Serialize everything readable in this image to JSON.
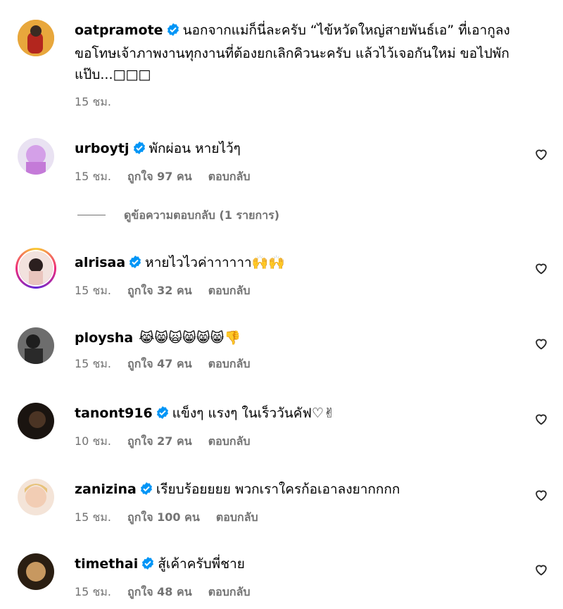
{
  "comments": [
    {
      "username": "oatpramote",
      "verified": true,
      "text": "นอกจากแม่ก็นี่ละครับ “ไข้หวัดใหญ่สายพันธ์เอ” ที่เอากูลง ขอโทษเจ้าภาพงานทุกงานที่ต้องยกเลิกคิวนะครับ แล้วไว้เจอกันใหม่ ขอไปพักแป๊บ...",
      "emoji_tail": "□□□",
      "time": "15 ชม.",
      "likes": "",
      "reply": "",
      "avatar_color": "#c0392b"
    },
    {
      "username": "urboytj",
      "verified": true,
      "text": "พักผ่อน หายไว้ๆ",
      "time": "15 ชม.",
      "likes": "ถูกใจ 97 คน",
      "reply": "ตอบกลับ",
      "avatar_color": "#d9b8f0"
    },
    {
      "username": "alrisaa",
      "verified": true,
      "text": "หายไวไวค่าาาาาา",
      "emoji_tail": "🙌🙌",
      "time": "15 ชม.",
      "likes": "ถูกใจ 32 คน",
      "reply": "ตอบกลับ",
      "avatar_color": "#e8c9c2"
    },
    {
      "username": "ploysha",
      "verified": false,
      "text": "",
      "emoji_tail": "😹😸🙀😸😸😸👎",
      "time": "15 ชม.",
      "likes": "ถูกใจ 47 คน",
      "reply": "ตอบกลับ",
      "avatar_color": "#4a4a4a"
    },
    {
      "username": "tanont916",
      "verified": true,
      "text": "แข็งๆ แรงๆ ในเร็ววันคัฟ",
      "emoji_tail": "♡✌",
      "time": "10 ชม.",
      "likes": "ถูกใจ 27 คน",
      "reply": "ตอบกลับ",
      "avatar_color": "#3b2f2a"
    },
    {
      "username": "zanizina",
      "verified": true,
      "text": "เรียบร้อยยยย พวกเราใครก้อเอาลงยากกกก",
      "time": "15 ชม.",
      "likes": "ถูกใจ 100 คน",
      "reply": "ตอบกลับ",
      "avatar_color": "#f0d6c4"
    },
    {
      "username": "timethai",
      "verified": true,
      "text": "สู้เค้าครับพี่ชาย",
      "time": "15 ชม.",
      "likes": "ถูกใจ 48 คน",
      "reply": "ตอบกลับ",
      "avatar_color": "#8a6a3a"
    }
  ],
  "view_replies": "ดูข้อความตอบกลับ (1 รายการ)",
  "colors": {
    "verified": "#0095f6",
    "meta": "#737373"
  }
}
